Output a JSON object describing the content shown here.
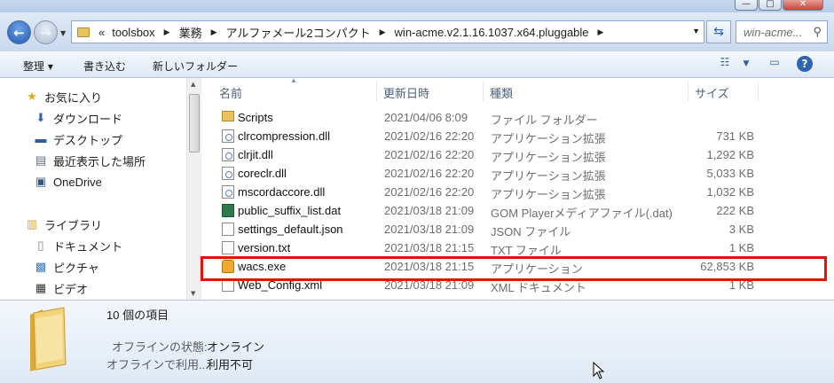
{
  "window": {
    "minimize": "—",
    "maximize": "□",
    "close": "✕"
  },
  "address": {
    "overflow": "«",
    "crumbs": [
      "toolsbox",
      "業務",
      "アルファメール2コンパクト",
      "win-acme.v2.1.16.1037.x64.pluggable"
    ],
    "search_placeholder": "win-acme..."
  },
  "toolbar": {
    "organize": "整理 ▾",
    "burn": "書き込む",
    "new_folder": "新しいフォルダー"
  },
  "nav": {
    "favorites": "お気に入り",
    "downloads": "ダウンロード",
    "desktop": "デスクトップ",
    "recent": "最近表示した場所",
    "onedrive": "OneDrive",
    "libraries": "ライブラリ",
    "documents": "ドキュメント",
    "pictures": "ピクチャ",
    "videos": "ビデオ"
  },
  "columns": {
    "name": "名前",
    "date": "更新日時",
    "type": "種類",
    "size": "サイズ"
  },
  "files": [
    {
      "name": "Scripts",
      "date": "2021/04/06 8:09",
      "type": "ファイル フォルダー",
      "size": "",
      "icon": "folder"
    },
    {
      "name": "clrcompression.dll",
      "date": "2021/02/16 22:20",
      "type": "アプリケーション拡張",
      "size": "731 KB",
      "icon": "dll"
    },
    {
      "name": "clrjit.dll",
      "date": "2021/02/16 22:20",
      "type": "アプリケーション拡張",
      "size": "1,292 KB",
      "icon": "dll"
    },
    {
      "name": "coreclr.dll",
      "date": "2021/02/16 22:20",
      "type": "アプリケーション拡張",
      "size": "5,033 KB",
      "icon": "dll"
    },
    {
      "name": "mscordaccore.dll",
      "date": "2021/02/16 22:20",
      "type": "アプリケーション拡張",
      "size": "1,032 KB",
      "icon": "dll"
    },
    {
      "name": "public_suffix_list.dat",
      "date": "2021/03/18 21:09",
      "type": "GOM Playerメディアファイル(.dat)",
      "size": "222 KB",
      "icon": "dat"
    },
    {
      "name": "settings_default.json",
      "date": "2021/03/18 21:09",
      "type": "JSON ファイル",
      "size": "3 KB",
      "icon": "doc"
    },
    {
      "name": "version.txt",
      "date": "2021/03/18 21:15",
      "type": "TXT ファイル",
      "size": "1 KB",
      "icon": "doc"
    },
    {
      "name": "wacs.exe",
      "date": "2021/03/18 21:15",
      "type": "アプリケーション",
      "size": "62,853 KB",
      "icon": "exe"
    },
    {
      "name": "Web_Config.xml",
      "date": "2021/03/18 21:09",
      "type": "XML ドキュメント",
      "size": "1 KB",
      "icon": "xml"
    }
  ],
  "details": {
    "count": "10 個の項目",
    "offline_status_label": "オフラインの状態:",
    "offline_status_value": "オンライン",
    "offline_use_label": "オフラインで利用...",
    "offline_use_value": "利用不可"
  },
  "colors": {
    "highlight": "#e3120b"
  }
}
